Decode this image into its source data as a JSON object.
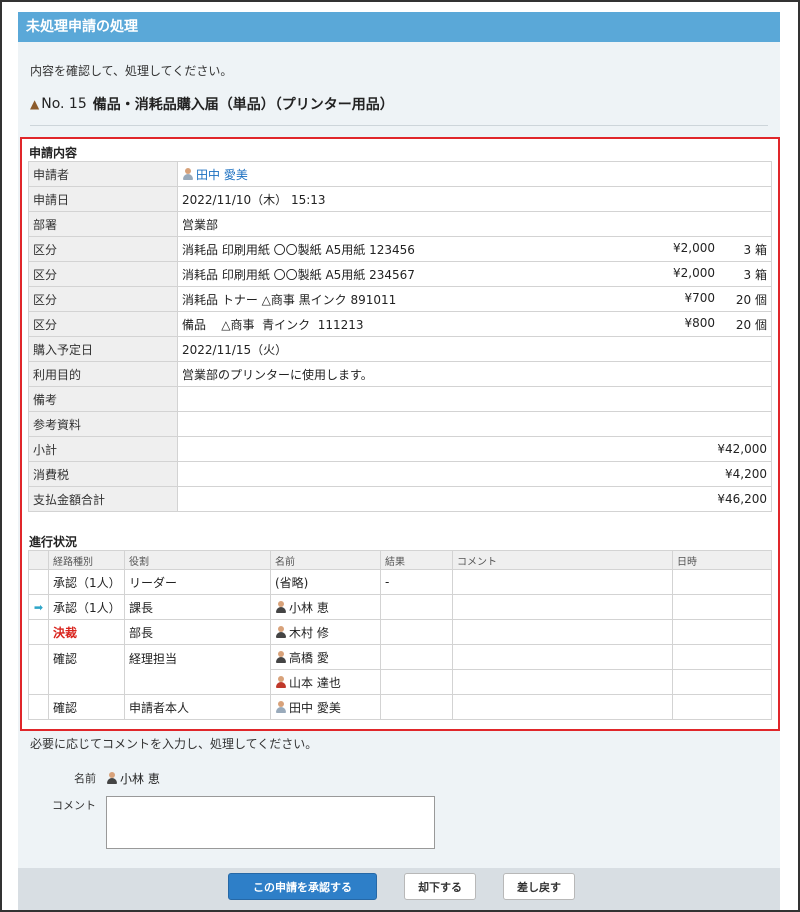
{
  "window": {
    "title": "未処理申請の処理"
  },
  "instruction": "内容を確認して、処理してください。",
  "request": {
    "number": "No. 15",
    "title": "備品・消耗品購入届（単品）（プリンター用品）"
  },
  "application": {
    "section_label": "申請内容",
    "applicant": {
      "label": "申請者",
      "value": "田中 愛美"
    },
    "date": {
      "label": "申請日",
      "value": "2022/11/10（木） 15:13"
    },
    "department": {
      "label": "部署",
      "value": "営業部"
    },
    "items": [
      {
        "label": "区分",
        "desc": "消耗品  印刷用紙  〇〇製紙  A5用紙  123456",
        "price": "¥2,000",
        "qty": "3 箱"
      },
      {
        "label": "区分",
        "desc": "消耗品  印刷用紙  〇〇製紙  A5用紙  234567",
        "price": "¥2,000",
        "qty": "3 箱"
      },
      {
        "label": "区分",
        "desc": "消耗品  トナー  △商事  黒インク  891011",
        "price": "¥700",
        "qty": "20 個"
      },
      {
        "label": "区分",
        "desc": "備品    △商事  青インク  111213",
        "price": "¥800",
        "qty": "20 個"
      }
    ],
    "purchase_date": {
      "label": "購入予定日",
      "value": "2022/11/15（火）"
    },
    "purpose": {
      "label": "利用目的",
      "value": "営業部のプリンターに使用します。"
    },
    "remarks": {
      "label": "備考",
      "value": ""
    },
    "reference": {
      "label": "参考資料",
      "value": ""
    },
    "subtotal": {
      "label": "小計",
      "value": "¥42,000"
    },
    "tax": {
      "label": "消費税",
      "value": "¥4,200"
    },
    "total": {
      "label": "支払金額合計",
      "value": "¥46,200"
    }
  },
  "progress": {
    "section_label": "進行状況",
    "headers": [
      "経路種別",
      "役割",
      "名前",
      "結果",
      "コメント",
      "日時"
    ],
    "rows": [
      {
        "type": "承認（1人）",
        "role": "リーダー",
        "names": [
          "(省略)"
        ],
        "result": "-",
        "comment": "",
        "datetime": ""
      },
      {
        "type": "承認（1人）",
        "role": "課長",
        "names": [
          "小林 恵"
        ],
        "result": "",
        "comment": "",
        "datetime": "",
        "current": true
      },
      {
        "type": "決裁",
        "role": "部長",
        "names": [
          "木村 修"
        ],
        "result": "",
        "comment": "",
        "datetime": ""
      },
      {
        "type": "確認",
        "role": "経理担当",
        "names": [
          "高橋 愛",
          "山本 達也"
        ],
        "result": "",
        "comment": "",
        "datetime": ""
      },
      {
        "type": "確認",
        "role": "申請者本人",
        "names": [
          "田中 愛美"
        ],
        "result": "",
        "comment": "",
        "datetime": ""
      }
    ],
    "current_marker": "➡"
  },
  "comment_section": {
    "instruction": "必要に応じてコメントを入力し、処理してください。",
    "name_label": "名前",
    "name_value": "小林 恵",
    "comment_label": "コメント",
    "comment_value": ""
  },
  "buttons": {
    "approve": "この申請を承認する",
    "reject": "却下する",
    "return": "差し戻す"
  },
  "colors": {
    "title_bar": "#5aa8d8",
    "highlight_border": "#e0262a",
    "primary_button": "#2e7fc8",
    "decision_text": "#d9241d"
  }
}
